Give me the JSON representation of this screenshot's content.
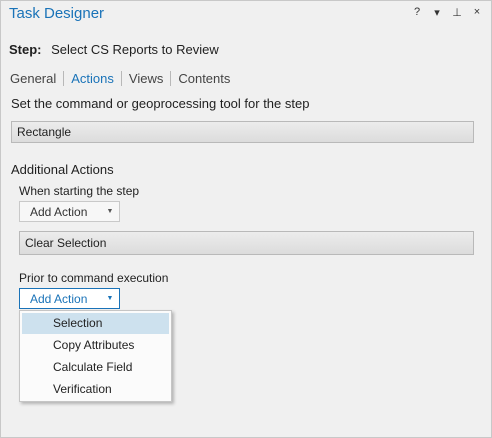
{
  "window": {
    "title": "Task Designer",
    "controls": {
      "help": "?",
      "menu": "▾",
      "pin": "⊥",
      "close": "×"
    }
  },
  "step": {
    "label": "Step:",
    "name": "Select CS Reports to Review"
  },
  "tabs": [
    {
      "label": "General",
      "active": false
    },
    {
      "label": "Actions",
      "active": true
    },
    {
      "label": "Views",
      "active": false
    },
    {
      "label": "Contents",
      "active": false
    }
  ],
  "command": {
    "description": "Set the command or geoprocessing tool for the step",
    "value": "Rectangle"
  },
  "additional_actions": {
    "heading": "Additional Actions",
    "when_starting": {
      "label": "When starting the step",
      "button": "Add Action",
      "action": "Clear Selection"
    },
    "prior_to_command": {
      "label": "Prior to command execution",
      "button": "Add Action"
    }
  },
  "dropdown_menu": {
    "items": [
      "Selection",
      "Copy Attributes",
      "Calculate Field",
      "Verification"
    ],
    "highlighted_index": 0
  },
  "colors": {
    "accent": "#1a73b8",
    "hover": "#cde1ee",
    "background": "#f0f0f0"
  }
}
